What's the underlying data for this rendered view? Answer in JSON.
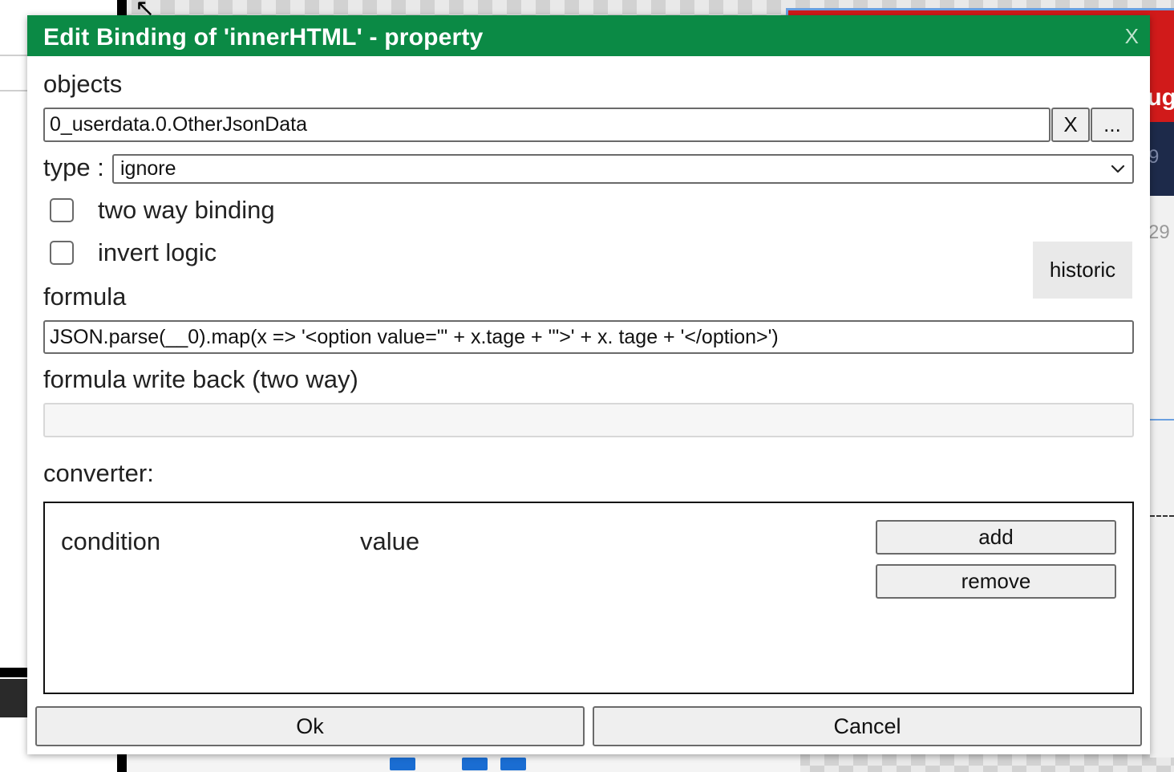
{
  "background": {
    "side_label": "ug",
    "number_top": "9",
    "number_mid": "29"
  },
  "dialog": {
    "title": "Edit Binding of 'innerHTML' - property",
    "close_label": "X",
    "objects": {
      "label": "objects",
      "value": "0_userdata.0.OtherJsonData",
      "clear_label": "X",
      "browse_label": "..."
    },
    "type": {
      "label": "type :",
      "selected": "ignore"
    },
    "two_way_binding": {
      "label": "two way binding",
      "checked": false
    },
    "invert_logic": {
      "label": "invert logic",
      "checked": false
    },
    "historic_label": "historic",
    "formula": {
      "label": "formula",
      "value": "JSON.parse(__0).map(x => '<option value=\"' + x.tage + '\">' + x. tage + '</option>')"
    },
    "formula_write_back": {
      "label": "formula write back (two way)",
      "value": ""
    },
    "converter": {
      "label": "converter:",
      "columns": [
        "condition",
        "value"
      ],
      "add_label": "add",
      "remove_label": "remove"
    },
    "ok_label": "Ok",
    "cancel_label": "Cancel"
  }
}
